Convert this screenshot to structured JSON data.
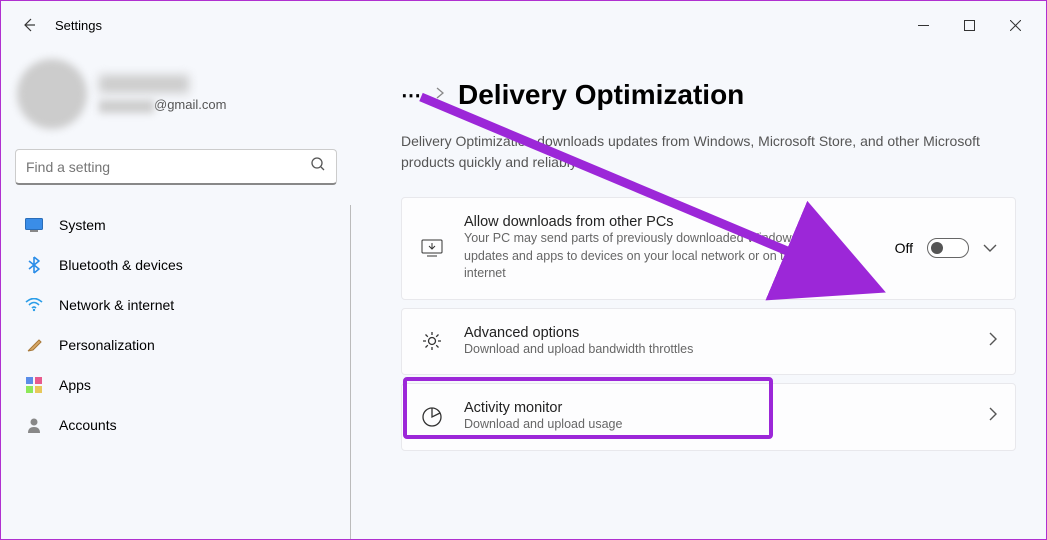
{
  "app_title": "Settings",
  "profile": {
    "email_suffix": "@gmail.com"
  },
  "search": {
    "placeholder": "Find a setting"
  },
  "nav": [
    {
      "label": "System"
    },
    {
      "label": "Bluetooth & devices"
    },
    {
      "label": "Network & internet"
    },
    {
      "label": "Personalization"
    },
    {
      "label": "Apps"
    },
    {
      "label": "Accounts"
    }
  ],
  "breadcrumb": {
    "title": "Delivery Optimization"
  },
  "page_description": "Delivery Optimization downloads updates from Windows, Microsoft Store, and other Microsoft products quickly and reliably.",
  "cards": {
    "allow_downloads": {
      "title": "Allow downloads from other PCs",
      "sub": "Your PC may send parts of previously downloaded Windows updates and apps to devices on your local network or on the internet",
      "toggle_state": "Off"
    },
    "advanced": {
      "title": "Advanced options",
      "sub": "Download and upload bandwidth throttles"
    },
    "activity": {
      "title": "Activity monitor",
      "sub": "Download and upload usage"
    }
  }
}
